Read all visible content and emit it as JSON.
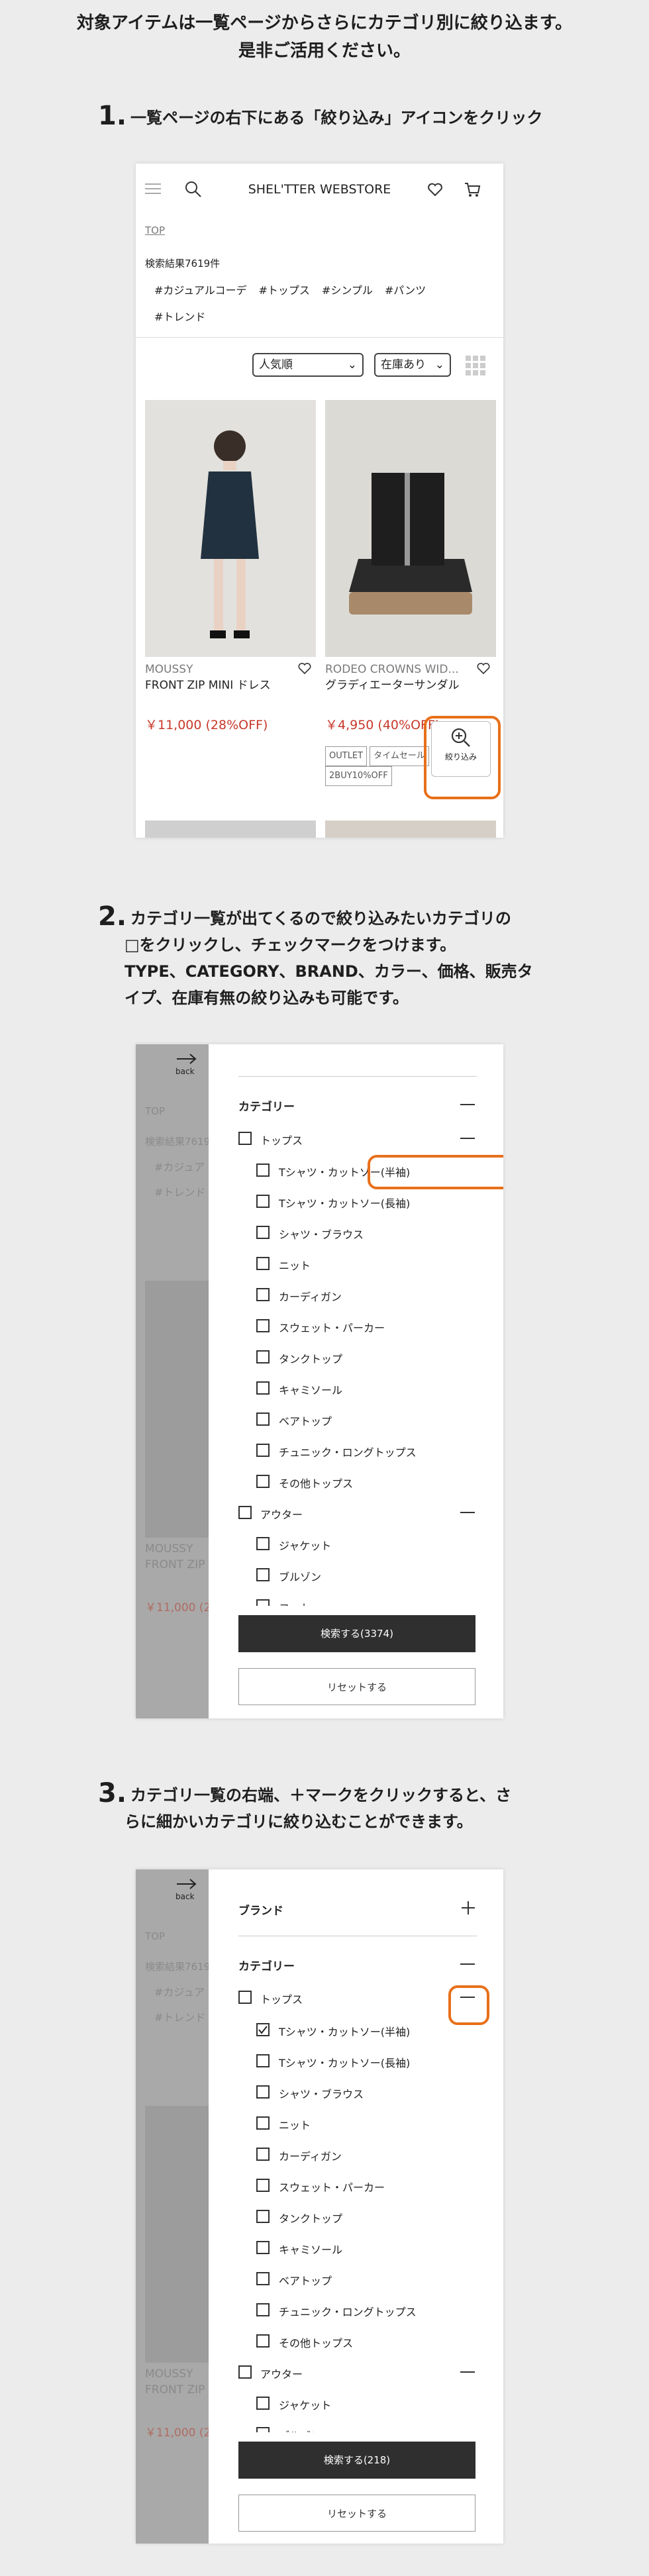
{
  "intro": {
    "line1": "対象アイテムは一覧ページからさらにカテゴリ別に絞り込ます。",
    "line2": "是非ご活用ください。"
  },
  "steps": [
    {
      "num": "1.",
      "line1": "一覧ページの右下にある「絞り込み」アイコンをクリック",
      "line2": "",
      "line3": ""
    },
    {
      "num": "2.",
      "line1": "カテゴリ一覧が出てくるので絞り込みたいカテゴリの",
      "line2": "□をクリックし、チェックマークをつけます。",
      "line3": "TYPE、CATEGORY、BRAND、カラー、価格、販売タイプ、在庫有無の絞り込みも可能です。"
    },
    {
      "num": "3.",
      "line1": "カテゴリ一覧の右端、＋マークをクリックすると、さ",
      "line2": "らに細かいカテゴリに絞り込むことができます。",
      "line3": ""
    }
  ],
  "screen1": {
    "store_title": "SHEL'TTER WEBSTORE",
    "breadcrumb": "TOP",
    "result_count": "検索結果7619件",
    "tags": [
      "#カジュアルコーデ",
      "#トップス",
      "#シンプル",
      "#パンツ",
      "#トレンド"
    ],
    "sort_value": "人気順",
    "stock_value": "在庫あり",
    "products": [
      {
        "brand": "MOUSSY",
        "name": "FRONT ZIP MINI ドレス",
        "price": "￥11,000 (28%OFF)",
        "badges": []
      },
      {
        "brand": "RODEO CROWNS WID...",
        "name": "グラディエーターサンダル",
        "price": "￥4,950 (40%OFF)",
        "badges": [
          "OUTLET",
          "タイムセール",
          "2BUY10%OFF"
        ]
      }
    ],
    "filter_label": "絞り込み"
  },
  "screen2": {
    "back_label": "back",
    "ghost": {
      "breadcrumb": "TOP",
      "count": "検索結果7619",
      "tag1": "#カジュア",
      "tag2": "#トレンド",
      "brand": "MOUSSY",
      "name": "FRONT ZIP",
      "price": "￥11,000 (2"
    },
    "category_heading": "カテゴリー",
    "parent1": "トップス",
    "children1": [
      "Tシャツ・カットソー(半袖)",
      "Tシャツ・カットソー(長袖)",
      "シャツ・ブラウス",
      "ニット",
      "カーディガン",
      "スウェット・パーカー",
      "タンクトップ",
      "キャミソール",
      "ベアトップ",
      "チュニック・ロングトップス",
      "その他トップス"
    ],
    "parent2": "アウター",
    "children2": [
      "ジャケット",
      "ブルゾン",
      "コート"
    ],
    "search_button": "検索する(3374)",
    "reset_button": "リセットする"
  },
  "screen3": {
    "back_label": "back",
    "ghost": {
      "breadcrumb": "TOP",
      "count": "検索結果7619",
      "tag1": "#カジュア",
      "tag2": "#トレンド",
      "brand": "MOUSSY",
      "name": "FRONT ZIP",
      "price": "￥11,000 (2"
    },
    "brand_heading": "ブランド",
    "category_heading": "カテゴリー",
    "parent1": "トップス",
    "children1": [
      "Tシャツ・カットソー(半袖)",
      "Tシャツ・カットソー(長袖)",
      "シャツ・ブラウス",
      "ニット",
      "カーディガン",
      "スウェット・パーカー",
      "タンクトップ",
      "キャミソール",
      "ベアトップ",
      "チュニック・ロングトップス",
      "その他トップス"
    ],
    "checked_child_index": 0,
    "parent2": "アウター",
    "children2": [
      "ジャケット",
      "ブルゾン"
    ],
    "search_button": "検索する(218)",
    "reset_button": "リセットする"
  },
  "colors": {
    "highlight": "#e8701a",
    "price": "#c8382a",
    "dark_button": "#2f2f2f"
  }
}
